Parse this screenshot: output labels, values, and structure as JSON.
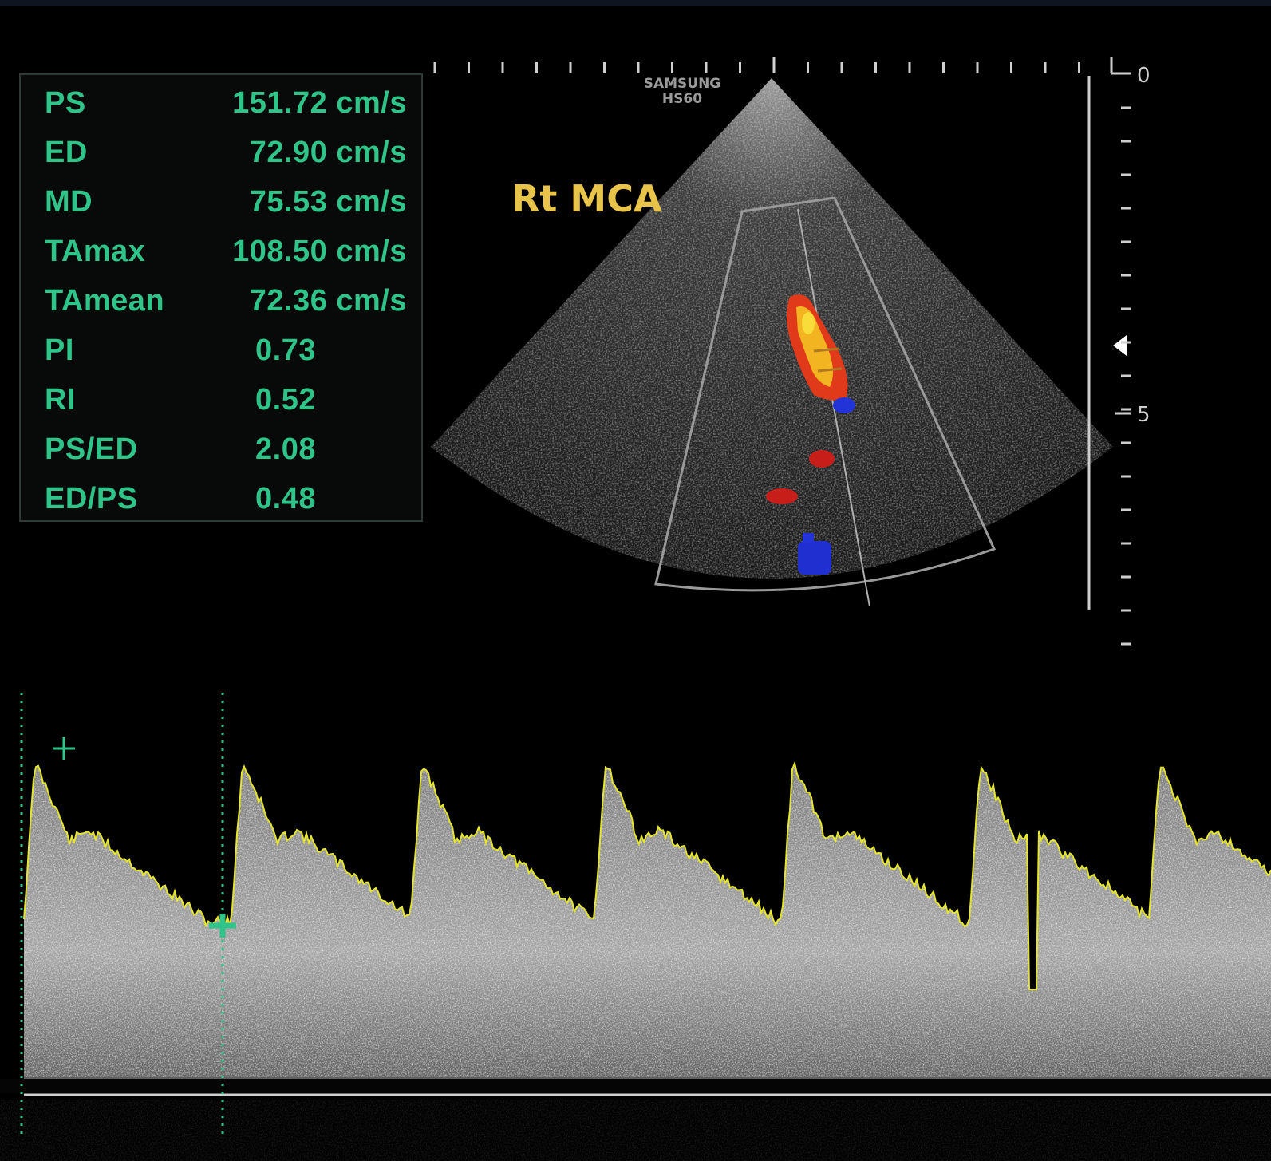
{
  "device": {
    "brand": "SAMSUNG",
    "model": "HS60"
  },
  "vessel_label": "Rt MCA",
  "measurements": [
    {
      "name": "PS",
      "value": "151.72 cm/s"
    },
    {
      "name": "ED",
      "value": "72.90 cm/s"
    },
    {
      "name": "MD",
      "value": "75.53 cm/s"
    },
    {
      "name": "TAmax",
      "value": "108.50 cm/s"
    },
    {
      "name": "TAmean",
      "value": "72.36 cm/s"
    },
    {
      "name": "PI",
      "value": "0.73"
    },
    {
      "name": "RI",
      "value": "0.52"
    },
    {
      "name": "PS/ED",
      "value": "2.08"
    },
    {
      "name": "ED/PS",
      "value": "0.48"
    }
  ],
  "depth_scale": {
    "labels": [
      "0",
      "5"
    ]
  },
  "colors": {
    "measurement_text": "#2fc48a",
    "vessel_label": "#e8c44a",
    "envelope_trace": "#e6e62a",
    "caliper": "#2fc48a"
  }
}
